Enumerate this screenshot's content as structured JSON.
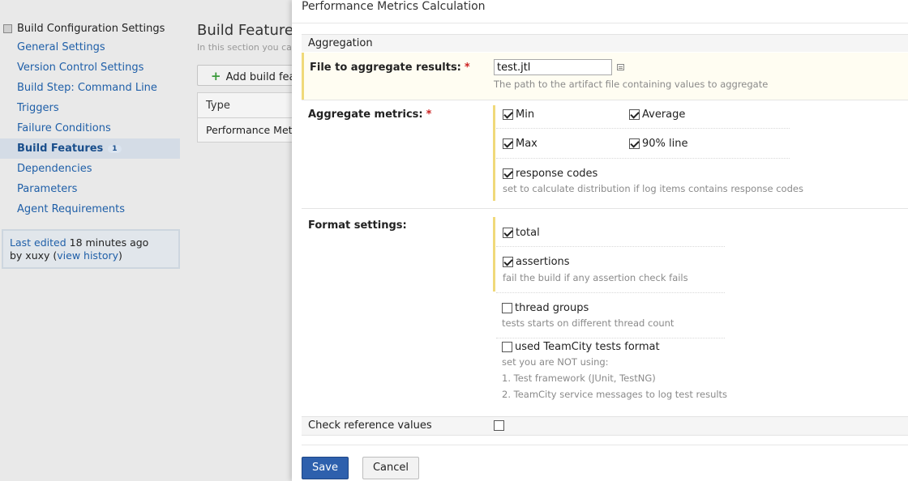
{
  "sidebar": {
    "header": "Build Configuration Settings",
    "items": [
      {
        "label": "General Settings"
      },
      {
        "label": "Version Control Settings"
      },
      {
        "label": "Build Step: Command Line"
      },
      {
        "label": "Triggers"
      },
      {
        "label": "Failure Conditions"
      },
      {
        "label": "Build Features",
        "count": "1",
        "active": true
      },
      {
        "label": "Dependencies"
      },
      {
        "label": "Parameters"
      },
      {
        "label": "Agent Requirements"
      }
    ],
    "last_edited": {
      "prefix": "Last edited",
      "time": "18 minutes ago",
      "by": "by xuxy (",
      "link": "view history",
      "suffix": ")"
    }
  },
  "main": {
    "title": "Build Features",
    "subtitle": "In this section you can",
    "add_button": "Add build featu",
    "table": {
      "header": "Type",
      "rows": [
        "Performance Metri"
      ]
    }
  },
  "dialog": {
    "title": "Performance Metrics Calculation",
    "section": "Aggregation",
    "file": {
      "label": "File to aggregate results:",
      "required": "*",
      "value": "test.jtl",
      "hint": "The path to the artifact file containing values to aggregate"
    },
    "metrics": {
      "label": "Aggregate metrics:",
      "required": "*",
      "min": {
        "label": "Min",
        "checked": true
      },
      "average": {
        "label": "Average",
        "checked": true
      },
      "max": {
        "label": "Max",
        "checked": true
      },
      "line90": {
        "label": "90% line",
        "checked": true
      },
      "response_codes": {
        "label": "response codes",
        "checked": true,
        "hint": "set to calculate distribution if log items contains response codes"
      }
    },
    "format": {
      "label": "Format settings:",
      "total": {
        "label": "total",
        "checked": true
      },
      "assertions": {
        "label": "assertions",
        "checked": true,
        "hint": "fail the build if any assertion check fails"
      },
      "thread_groups": {
        "label": "thread groups",
        "checked": false,
        "hint": "tests starts on different thread count"
      },
      "teamcity": {
        "label": "used TeamCity tests format",
        "checked": false,
        "hint1": "set you are NOT using:",
        "hint2": "1. Test framework (JUnit, TestNG)",
        "hint3": "2. TeamCity service messages to log test results"
      }
    },
    "check_reference": {
      "label": "Check reference values",
      "checked": false
    },
    "save": "Save",
    "cancel": "Cancel"
  },
  "colors": {
    "accent": "#2e60ad",
    "link": "#1f5fa8",
    "highlight_bar": "#f0d97a",
    "required": "#cc2222"
  },
  "icons": [
    "config-box-icon",
    "plus-icon",
    "list-icon",
    "checkbox-checked-icon"
  ]
}
